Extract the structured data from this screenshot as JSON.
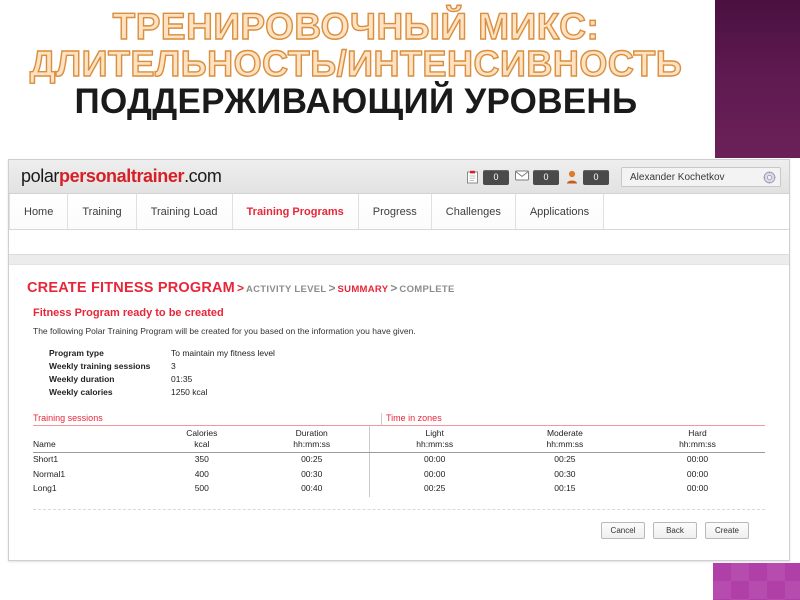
{
  "slide": {
    "title_line1": "ТРЕНИРОВОЧНЫЙ МИКС:",
    "title_line2": "ДЛИТЕЛЬНОСТЬ/ИНТЕНСИВНОСТЬ",
    "title_line3": "ПОДДЕРЖИВАЮЩИЙ УРОВЕНЬ",
    "accent_purple": "#5e1a50",
    "accent_magenta": "#b040a8",
    "outline_color": "#d98f3f",
    "outline_fill": "#ffe2c2"
  },
  "browser": {
    "header": {
      "logo_part1": "polar",
      "logo_part2": "personaltrainer",
      "logo_part3": ".com",
      "counters": [
        {
          "icon": "clipboard-icon",
          "glyph": "📋",
          "value": "0"
        },
        {
          "icon": "envelope-icon",
          "glyph": "✉",
          "value": "0"
        },
        {
          "icon": "person-icon",
          "glyph": "👤",
          "value": "0"
        }
      ],
      "user_name": "Alexander Kochetkov",
      "settings_icon": "gear-icon"
    },
    "nav": {
      "tabs": [
        {
          "label": "Home",
          "active": false
        },
        {
          "label": "Training",
          "active": false
        },
        {
          "label": "Training Load",
          "active": false
        },
        {
          "label": "Training Programs",
          "active": true
        },
        {
          "label": "Progress",
          "active": false
        },
        {
          "label": "Challenges",
          "active": false
        },
        {
          "label": "Applications",
          "active": false
        }
      ],
      "active_color": "#e8263a"
    },
    "breadcrumb": {
      "main": "CREATE FITNESS PROGRAM",
      "sep1": ">",
      "step1": "ACTIVITY LEVEL",
      "sep2": ">",
      "step2": "SUMMARY",
      "sep3": ">",
      "step3": "COMPLETE"
    },
    "content": {
      "ready_heading": "Fitness Program ready to be created",
      "intro_text": "The following Polar Training Program will be created for you based on the information you have given.",
      "summary": [
        {
          "label": "Program type",
          "value": "To maintain my fitness level"
        },
        {
          "label": "Weekly training sessions",
          "value": "3"
        },
        {
          "label": "Weekly duration",
          "value": "01:35"
        },
        {
          "label": "Weekly calories",
          "value": "1250 kcal"
        }
      ],
      "table": {
        "group_left": "Training sessions",
        "group_right": "Time in zones",
        "headers": [
          {
            "title": "Name",
            "sub": ""
          },
          {
            "title": "Calories",
            "sub": "kcal"
          },
          {
            "title": "Duration",
            "sub": "hh:mm:ss"
          },
          {
            "title": "Light",
            "sub": "hh:mm:ss"
          },
          {
            "title": "Moderate",
            "sub": "hh:mm:ss"
          },
          {
            "title": "Hard",
            "sub": "hh:mm:ss"
          }
        ],
        "rows": [
          {
            "name": "Short1",
            "calories": "350",
            "duration": "00:25",
            "light": "00:00",
            "moderate": "00:25",
            "hard": "00:00"
          },
          {
            "name": "Normal1",
            "calories": "400",
            "duration": "00:30",
            "light": "00:00",
            "moderate": "00:30",
            "hard": "00:00"
          },
          {
            "name": "Long1",
            "calories": "500",
            "duration": "00:40",
            "light": "00:25",
            "moderate": "00:15",
            "hard": "00:00"
          }
        ]
      },
      "buttons": [
        {
          "label": "Cancel"
        },
        {
          "label": "Back"
        },
        {
          "label": "Create"
        }
      ]
    }
  }
}
